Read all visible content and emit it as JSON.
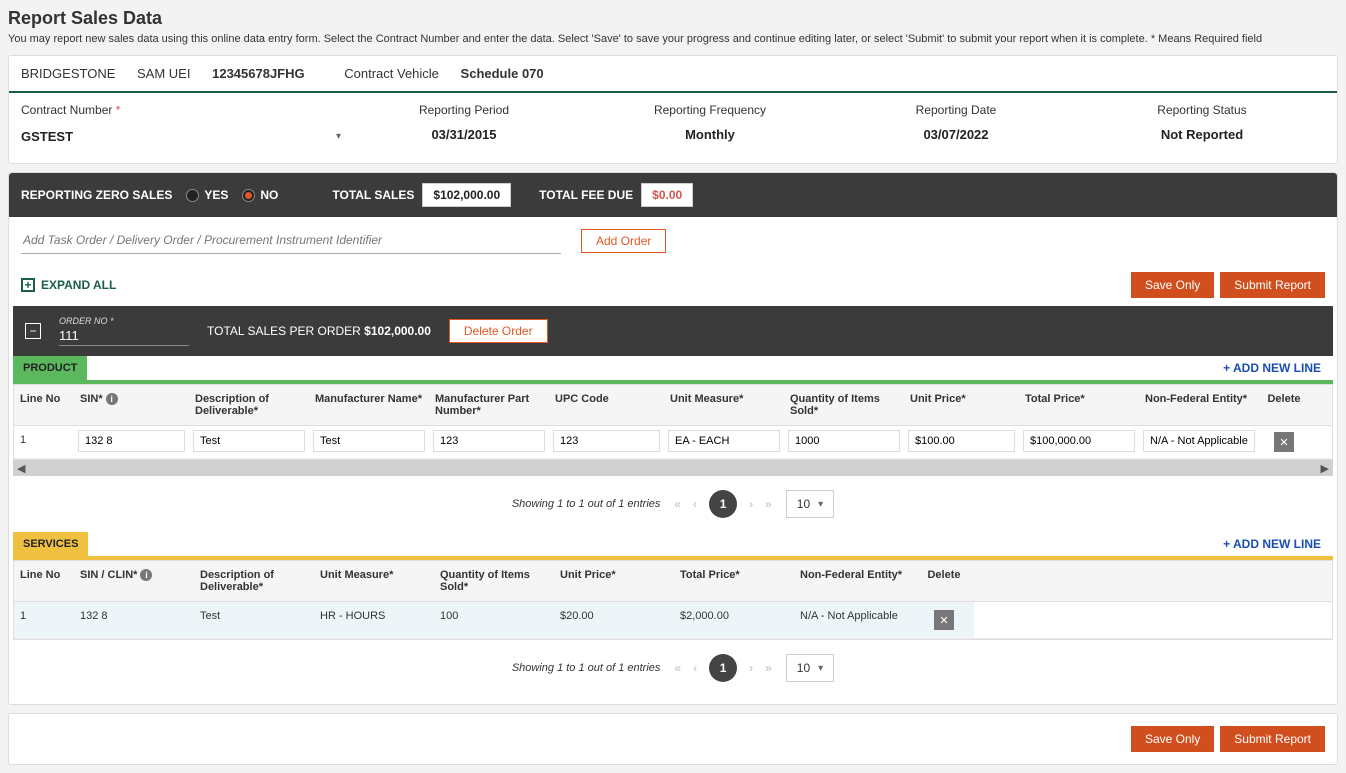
{
  "page": {
    "title": "Report Sales Data",
    "description": "You may report new sales data using this online data entry form. Select the Contract Number and enter the data. Select 'Save' to save your progress and continue editing later, or select 'Submit' to submit your report when it is complete. * Means Required field"
  },
  "header": {
    "vendor": "BRIDGESTONE",
    "uei_label": "SAM UEI",
    "uei_value": "12345678JFHG",
    "vehicle_label": "Contract Vehicle",
    "vehicle_value": "Schedule 070"
  },
  "info": {
    "contract_label": "Contract Number",
    "contract_value": "GSTEST",
    "period_label": "Reporting Period",
    "period_value": "03/31/2015",
    "freq_label": "Reporting Frequency",
    "freq_value": "Monthly",
    "date_label": "Reporting Date",
    "date_value": "03/07/2022",
    "status_label": "Reporting Status",
    "status_value": "Not Reported"
  },
  "zero_sales": {
    "label": "REPORTING ZERO SALES",
    "yes": "YES",
    "no": "NO",
    "selected": "NO",
    "total_sales_label": "TOTAL SALES",
    "total_sales_value": "$102,000.00",
    "total_fee_label": "TOTAL FEE DUE",
    "total_fee_value": "$0.00"
  },
  "add_order": {
    "placeholder": "Add Task Order / Delivery Order / Procurement Instrument Identifier",
    "button": "Add Order"
  },
  "actions": {
    "expand_all": "EXPAND ALL",
    "save_only": "Save Only",
    "submit": "Submit Report"
  },
  "order": {
    "no_label": "ORDER NO *",
    "no_value": "111",
    "total_label": "TOTAL SALES PER ORDER",
    "total_value": "$102,000.00",
    "delete": "Delete Order"
  },
  "product": {
    "tab": "PRODUCT",
    "add_line": "+ ADD NEW LINE",
    "headers": {
      "line_no": "Line No",
      "sin": "SIN*",
      "desc": "Description of Deliverable*",
      "mfr_name": "Manufacturer Name*",
      "mfr_part": "Manufacturer Part Number*",
      "upc": "UPC Code",
      "unit": "Unit Measure*",
      "qty": "Quantity of Items Sold*",
      "unit_price": "Unit Price*",
      "total_price": "Total Price*",
      "nfe": "Non-Federal Entity*",
      "delete": "Delete"
    },
    "row": {
      "line_no": "1",
      "sin": "132 8",
      "desc": "Test",
      "mfr_name": "Test",
      "mfr_part": "123",
      "upc": "123",
      "unit": "EA - EACH",
      "qty": "1000",
      "unit_price": "$100.00",
      "total_price": "$100,000.00",
      "nfe": "N/A - Not Applicable"
    }
  },
  "services": {
    "tab": "SERVICES",
    "add_line": "+ ADD NEW LINE",
    "headers": {
      "line_no": "Line No",
      "sin": "SIN / CLIN*",
      "desc": "Description of Deliverable*",
      "unit": "Unit Measure*",
      "qty": "Quantity of Items Sold*",
      "unit_price": "Unit Price*",
      "total_price": "Total Price*",
      "nfe": "Non-Federal Entity*",
      "delete": "Delete"
    },
    "row": {
      "line_no": "1",
      "sin": "132 8",
      "desc": "Test",
      "unit": "HR - HOURS",
      "qty": "100",
      "unit_price": "$20.00",
      "total_price": "$2,000.00",
      "nfe": "N/A - Not Applicable"
    }
  },
  "pager": {
    "info": "Showing 1 to 1 out of 1 entries",
    "current": "1",
    "size": "10"
  }
}
